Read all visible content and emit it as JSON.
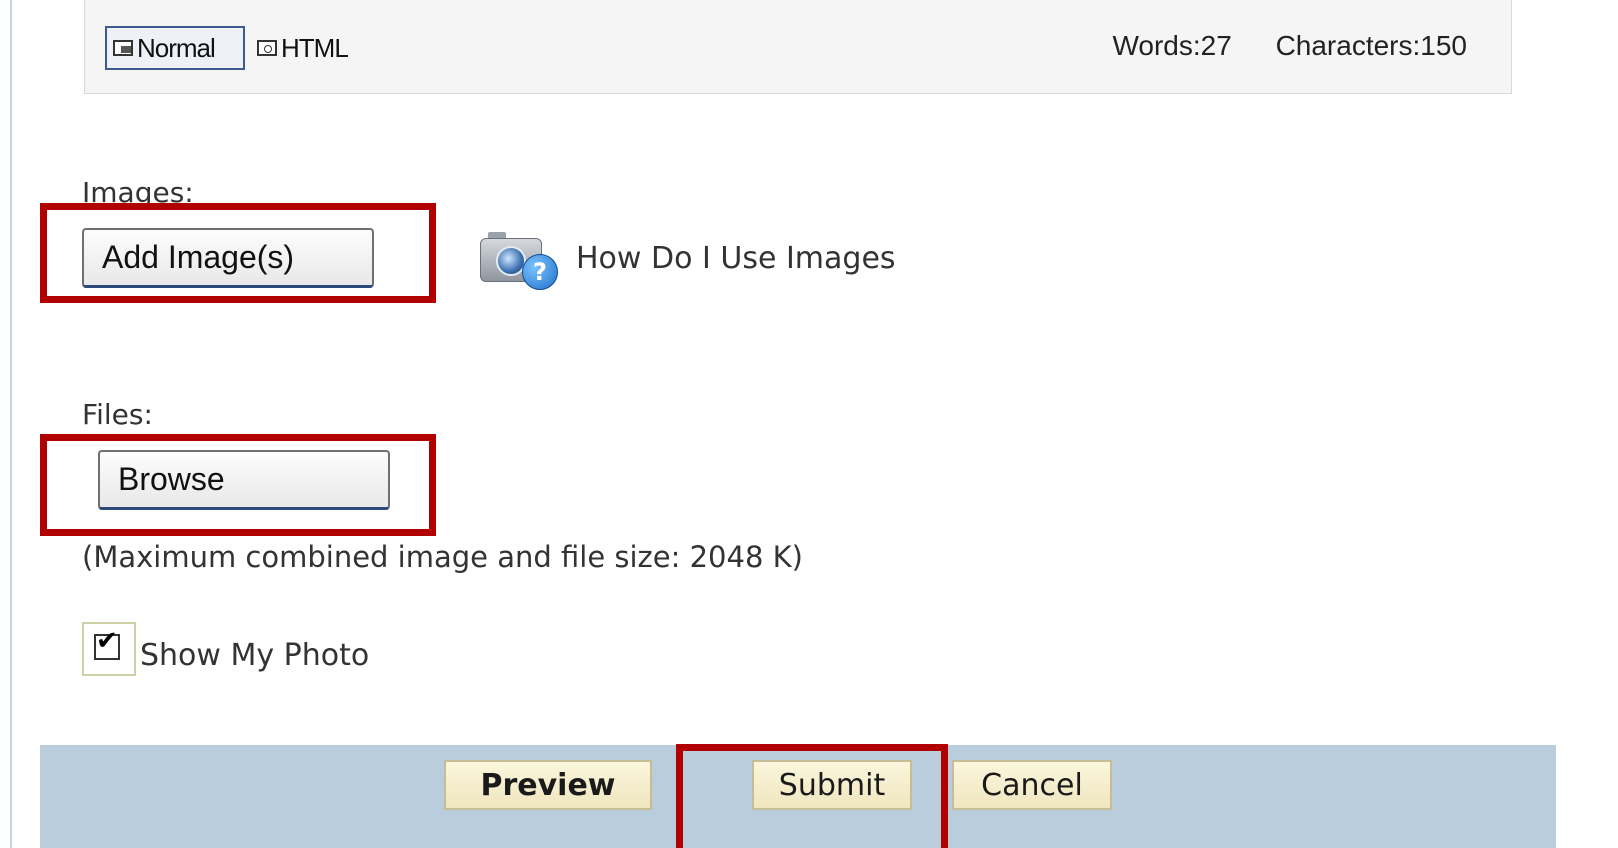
{
  "editor": {
    "mode_normal_label": "Normal",
    "mode_html_label": "HTML",
    "words_label": "Words:27",
    "characters_label": "Characters:150"
  },
  "images": {
    "label": "Images:",
    "add_button_label": "Add Image(s)",
    "help_link_label": "How Do I Use Images",
    "help_icon": "camera-help-icon"
  },
  "files": {
    "label": "Files:",
    "browse_button_label": "Browse",
    "size_note": "(Maximum combined image and file size: 2048 K)"
  },
  "show_photo": {
    "label": "Show My Photo",
    "checked": true
  },
  "actions": {
    "preview_label": "Preview",
    "submit_label": "Submit",
    "cancel_label": "Cancel"
  },
  "colors": {
    "highlight": "#b00000",
    "action_bar": "#b9cddd",
    "action_button": "#f3ecc9"
  }
}
